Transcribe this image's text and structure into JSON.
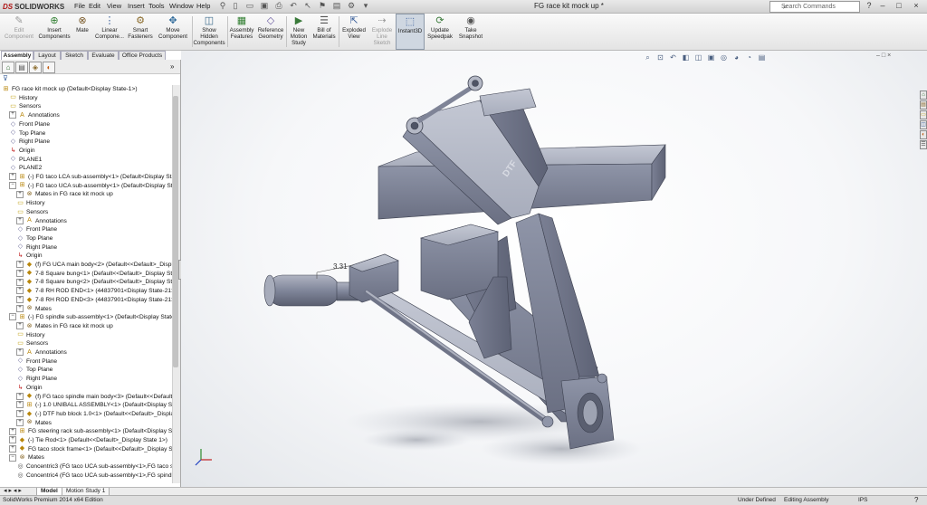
{
  "app": {
    "logo": "SOLIDWORKS",
    "logo_mark": "DS",
    "document_title": "FG race kit mock up *"
  },
  "menu": [
    "File",
    "Edit",
    "View",
    "Insert",
    "Tools",
    "Window",
    "Help"
  ],
  "search": {
    "placeholder": "Search Commands"
  },
  "window_controls": {
    "help": "?",
    "minimize": "–",
    "restore": "□",
    "close": "×"
  },
  "commands": [
    {
      "label": "Edit\nComponent",
      "icon": "✎"
    },
    {
      "label": "Insert\nComponents",
      "icon": "⊕"
    },
    {
      "label": "Mate",
      "icon": "⊗"
    },
    {
      "label": "Linear\nCompone...",
      "icon": "⋮"
    },
    {
      "label": "Smart\nFasteners",
      "icon": "⚙"
    },
    {
      "label": "Move\nComponent",
      "icon": "✥"
    },
    {
      "label": "Show\nHidden\nComponents",
      "icon": "◫"
    },
    {
      "label": "Assembly\nFeatures",
      "icon": "▦"
    },
    {
      "label": "Reference\nGeometry",
      "icon": "◇"
    },
    {
      "label": "New\nMotion\nStudy",
      "icon": "▶"
    },
    {
      "label": "Bill of\nMaterials",
      "icon": "☰"
    },
    {
      "label": "Exploded\nView",
      "icon": "⇱"
    },
    {
      "label": "Explode\nLine\nSketch",
      "icon": "⇢"
    },
    {
      "label": "Instant3D",
      "icon": "⬚"
    },
    {
      "label": "Update\nSpeedpak",
      "icon": "⟳"
    },
    {
      "label": "Take\nSnapshot",
      "icon": "◉"
    }
  ],
  "tabs": [
    "Assembly",
    "Layout",
    "Sketch",
    "Evaluate",
    "Office Products"
  ],
  "tree": [
    {
      "label": "FG race kit mock up  (Default<Display State-1>)",
      "icon": "asm"
    },
    {
      "label": "History",
      "icon": "folder"
    },
    {
      "label": "Sensors",
      "icon": "folder"
    },
    {
      "label": "Annotations",
      "icon": "A"
    },
    {
      "label": "Front Plane",
      "icon": "plane"
    },
    {
      "label": "Top Plane",
      "icon": "plane"
    },
    {
      "label": "Right Plane",
      "icon": "plane"
    },
    {
      "label": "Origin",
      "icon": "origin"
    },
    {
      "label": "PLANE1",
      "icon": "plane"
    },
    {
      "label": "PLANE2",
      "icon": "plane"
    },
    {
      "label": "(-) FG taco LCA sub-assembly<1> (Default<Display State-1",
      "icon": "asm"
    },
    {
      "label": "(-) FG taco UCA sub-assembly<1> (Default<Display State-1",
      "icon": "asm"
    },
    {
      "label": "Mates in FG race kit mock up",
      "icon": "mate"
    },
    {
      "label": "History",
      "icon": "folder"
    },
    {
      "label": "Sensors",
      "icon": "folder"
    },
    {
      "label": "Annotations",
      "icon": "A"
    },
    {
      "label": "Front Plane",
      "icon": "plane"
    },
    {
      "label": "Top Plane",
      "icon": "plane"
    },
    {
      "label": "Right Plane",
      "icon": "plane"
    },
    {
      "label": "Origin",
      "icon": "origin"
    },
    {
      "label": "(f) FG UCA main body<2> (Default<<Default>_Display",
      "icon": "part"
    },
    {
      "label": "7-8 Square bung<1> (Default<<Default>_Display State",
      "icon": "part"
    },
    {
      "label": "7-8 Square bung<2> (Default<<Default>_Display State",
      "icon": "part"
    },
    {
      "label": "7-8 RH ROD END<1> (44837901<Display State-21>)",
      "icon": "part"
    },
    {
      "label": "7-8 RH ROD END<3> (44837901<Display State-21>)",
      "icon": "part"
    },
    {
      "label": "Mates",
      "icon": "mate"
    },
    {
      "label": "(-) FG spindle sub-assembly<1> (Default<Display State-1>)",
      "icon": "asm"
    },
    {
      "label": "Mates in FG race kit mock up",
      "icon": "mate"
    },
    {
      "label": "History",
      "icon": "folder"
    },
    {
      "label": "Sensors",
      "icon": "folder"
    },
    {
      "label": "Annotations",
      "icon": "A"
    },
    {
      "label": "Front Plane",
      "icon": "plane"
    },
    {
      "label": "Top Plane",
      "icon": "plane"
    },
    {
      "label": "Right Plane",
      "icon": "plane"
    },
    {
      "label": "Origin",
      "icon": "origin"
    },
    {
      "label": "(f) FG taco spindle main body<3> (Default<<Default>_I",
      "icon": "part"
    },
    {
      "label": "(-) 1.0 UNIBALL ASSEMBLY<1> (Default<Display State-1",
      "icon": "asm"
    },
    {
      "label": "(-) DTF hub block 1.0<1> (Default<<Default>_Display S",
      "icon": "part"
    },
    {
      "label": "Mates",
      "icon": "mate"
    },
    {
      "label": "FG steering rack sub-assembly<1> (Default<Display State-1",
      "icon": "asm"
    },
    {
      "label": "(-) Tie Rod<1> (Default<<Default>_Display State 1>)",
      "icon": "part"
    },
    {
      "label": "FG taco stock frame<1> (Default<<Default>_Display State",
      "icon": "part"
    },
    {
      "label": "Mates",
      "icon": "mate"
    },
    {
      "label": "Concentric3 (FG taco UCA sub-assembly<1>,FG taco sto",
      "icon": "conc"
    },
    {
      "label": "Concentric4 (FG taco UCA sub-assembly<1>,FG spindle",
      "icon": "conc"
    }
  ],
  "viewport": {
    "dimension": "3.31",
    "engraving": "DTF"
  },
  "bottom_tabs": [
    "Model",
    "Motion Study 1"
  ],
  "status": {
    "left": "SolidWorks Premium 2014 x64 Edition",
    "state": "Under Defined",
    "mode": "Editing Assembly",
    "units": "IPS"
  }
}
